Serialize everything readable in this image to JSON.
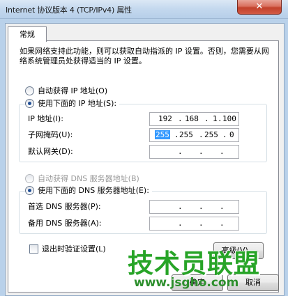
{
  "window": {
    "title": "Internet 协议版本 4 (TCP/IPv4) 属性",
    "close_glyph": "✕"
  },
  "tab": {
    "label": "常规"
  },
  "description": "如果网络支持此功能，则可以获取自动指派的 IP 设置。否则，您需要从网络系统管理员处获得适当的 IP 设置。",
  "ip_section": {
    "auto_label": "自动获得 IP 地址(O)",
    "manual_label": "使用下面的 IP 地址(S):",
    "selected": "manual",
    "ip_label": "IP 地址(I):",
    "ip_value": [
      "192",
      "168",
      "1",
      "100"
    ],
    "subnet_label": "子网掩码(U):",
    "subnet_value": [
      "255",
      "255",
      "255",
      "0"
    ],
    "gateway_label": "默认网关(D):",
    "gateway_value": [
      "",
      "",
      "",
      ""
    ]
  },
  "dns_section": {
    "auto_label": "自动获得 DNS 服务器地址(B)",
    "manual_label": "使用下面的 DNS 服务器地址(E):",
    "selected": "manual",
    "preferred_label": "首选 DNS 服务器(P):",
    "alternate_label": "备用 DNS 服务器(A):"
  },
  "validate_checkbox": {
    "label": "退出时验证设置(L)",
    "checked": false
  },
  "buttons": {
    "advanced": "高级(V)...",
    "ok": "确定",
    "cancel": "取消"
  },
  "watermark": {
    "text": "技术员联盟",
    "url": "www.jsgho.com"
  },
  "colors": {
    "selection": "#3399ff",
    "watermark": "#27a427",
    "close_button": "#c2412b"
  }
}
